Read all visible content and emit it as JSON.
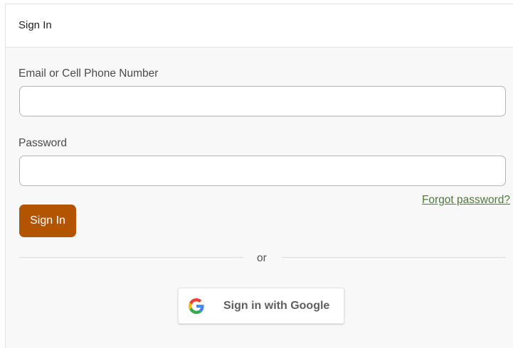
{
  "header": {
    "title": "Sign In"
  },
  "form": {
    "email_label": "Email or Cell Phone Number",
    "email_value": "",
    "password_label": "Password",
    "password_value": "",
    "forgot_link": "Forgot password?",
    "submit_label": "Sign In"
  },
  "divider": {
    "text": "or"
  },
  "google": {
    "label": "Sign in with Google",
    "icon": "google-g-icon"
  },
  "colors": {
    "primary_button": "#b35400",
    "link": "#4e7a3a"
  }
}
